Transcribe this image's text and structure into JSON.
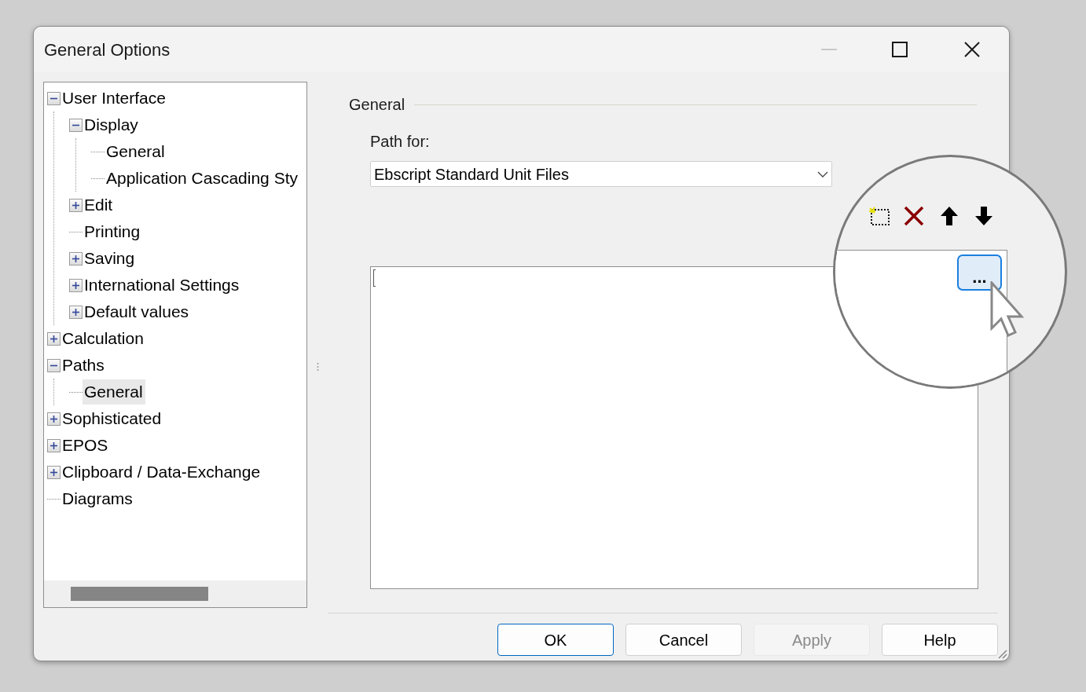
{
  "window": {
    "title": "General Options"
  },
  "tree": {
    "items": [
      {
        "label": "User Interface",
        "kind": "folder",
        "expanded": true,
        "selected": false,
        "children": [
          {
            "label": "Display",
            "kind": "folder",
            "expanded": true,
            "selected": false,
            "children": [
              {
                "label": "General",
                "kind": "leaf",
                "selected": false
              },
              {
                "label": "Application Cascading Sty",
                "kind": "leaf",
                "selected": false
              }
            ]
          },
          {
            "label": "Edit",
            "kind": "folder",
            "expanded": false,
            "selected": false
          },
          {
            "label": "Printing",
            "kind": "leaf",
            "selected": false
          },
          {
            "label": "Saving",
            "kind": "folder",
            "expanded": false,
            "selected": false
          },
          {
            "label": "International Settings",
            "kind": "folder",
            "expanded": false,
            "selected": false
          },
          {
            "label": "Default values",
            "kind": "folder",
            "expanded": false,
            "selected": false
          }
        ]
      },
      {
        "label": "Calculation",
        "kind": "folder",
        "expanded": false,
        "selected": false
      },
      {
        "label": "Paths",
        "kind": "folder",
        "expanded": true,
        "selected": false,
        "children": [
          {
            "label": "General",
            "kind": "leaf",
            "selected": true
          }
        ]
      },
      {
        "label": "Sophisticated",
        "kind": "folder",
        "expanded": false,
        "selected": false
      },
      {
        "label": "EPOS",
        "kind": "folder",
        "expanded": false,
        "selected": false
      },
      {
        "label": "Clipboard / Data-Exchange",
        "kind": "folder",
        "expanded": false,
        "selected": false
      },
      {
        "label": "Diagrams",
        "kind": "leaf",
        "selected": false
      }
    ]
  },
  "group": {
    "title": "General"
  },
  "path_for": {
    "label": "Path for:",
    "value": "Ebscript Standard Unit Files"
  },
  "magnifier": {
    "browse_button": {
      "label": "..."
    }
  },
  "buttons": [
    {
      "label": "OK",
      "default": true,
      "disabled": false
    },
    {
      "label": "Cancel",
      "default": false,
      "disabled": false
    },
    {
      "label": "Apply",
      "default": false,
      "disabled": true
    },
    {
      "label": "Help",
      "default": false,
      "disabled": false
    }
  ]
}
